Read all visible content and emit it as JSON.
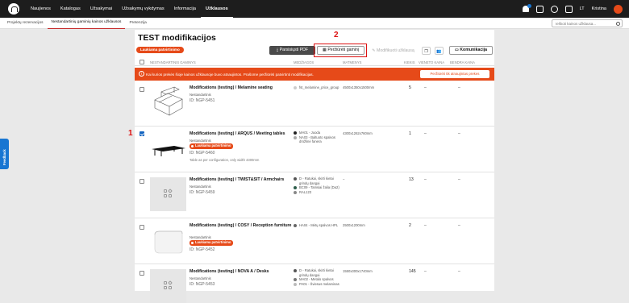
{
  "topnav": {
    "items": [
      "Naujienos",
      "Katalogas",
      "Užsakymai",
      "Užsakymų vykdymas",
      "Informacija",
      "Užklausos"
    ],
    "active_index": 5,
    "language": "LT",
    "user": "Kristina"
  },
  "subtabs": {
    "items": [
      "Projektų rezervacijos",
      "Nestandartinių gaminių kainos užklausos",
      "Pretenzija"
    ],
    "active_index": 1
  },
  "search": {
    "placeholder": "Ieškoti kainos užklausa..."
  },
  "page": {
    "title": "TEST modifikacijos",
    "status": "Laukiama patvirtinimo"
  },
  "toolbar": {
    "pdf_label": "Parsisiųsti PDF",
    "view_label": "Peržiūrėti gaminį",
    "modify_label": "Modifikuoti užklausą",
    "comm_label": "Komunikacija"
  },
  "table": {
    "headers": [
      "NESTANDARTINIS GAMINYS",
      "MEDŽIAGOS",
      "MATMENYS",
      "KIEKIS",
      "VIENETO KAINA",
      "BENDRA KAINA"
    ]
  },
  "alert": {
    "text": "Kai kurios prekės šioje kainos užklausoje buvo atnaujintos. Prašome peržiūrėti patvirtinti modifikacijas.",
    "button": "Peržiūrėti tik atnaujintas prekes"
  },
  "rows": [
    {
      "name": "Modifications (testing) / Melamine seating",
      "type": "Nestandartinis",
      "id": "ID: NGP-5451",
      "materials": [
        {
          "text": "fst_melamine_price_group",
          "color": "#cccccc"
        }
      ],
      "dims": "4500x1350x1500mm",
      "qty": "5",
      "unit_price": "–",
      "total_price": "–",
      "checked": false,
      "badge": ""
    },
    {
      "name": "Modifications (testing) / ARQUS / Meeting tables",
      "type": "Nestandartinis",
      "id": "ID: NGP-5460",
      "note": "Table as per configuration, only width 4300mm",
      "materials": [
        {
          "text": "MA01 - Juoda",
          "color": "#222222"
        },
        {
          "text": "NA03 - Baltuoto spalvos drožlinė fanera",
          "color": "#aaaaaa"
        }
      ],
      "dims": "4300x1262x760mm",
      "qty": "1",
      "unit_price": "–",
      "total_price": "–",
      "checked": true,
      "badge": "Laukiama patvirtinimo"
    },
    {
      "name": "Modifications (testing) / TWIST&SIT / Armchairs",
      "type": "Nestandartinis",
      "id": "ID: NGP-5459",
      "materials": [
        {
          "text": "D - Ratukai, skirti kietai grindų dangai",
          "color": "#555555"
        },
        {
          "text": "BC09 - Tamsiai žalia (Da2)",
          "color": "#2e5d4b"
        },
        {
          "text": "RAL123",
          "color": "#888888"
        }
      ],
      "dims": "–",
      "qty": "13",
      "unit_price": "–",
      "total_price": "–",
      "checked": false,
      "badge": ""
    },
    {
      "name": "Modifications (testing) / COSY / Reception furniture",
      "type": "Nestandartinis",
      "id": "ID: NGP-5452",
      "materials": [
        {
          "text": "HA04 - Mėtų spalvos HPL",
          "color": "#666666"
        }
      ],
      "dims": "2500x1200mm",
      "qty": "2",
      "unit_price": "–",
      "total_price": "–",
      "checked": false,
      "badge": "Laukiama patvirtinimo"
    },
    {
      "name": "Modifications (testing) / NOVA A / Desks",
      "type": "Nestandartinis",
      "id": "ID: NGP-5453",
      "materials": [
        {
          "text": "D - Ratukai, skirti kietai grindų dangai",
          "color": "#555555"
        },
        {
          "text": "MA02 - Metalo spalvos",
          "color": "#777777"
        },
        {
          "text": "PA01 - Šviesus melaminas",
          "color": "#bbbbbb"
        }
      ],
      "dims": "1550x300x1740mm",
      "qty": "145",
      "unit_price": "–",
      "total_price": "–",
      "checked": false,
      "badge": ""
    }
  ],
  "feedback_label": "Feedback",
  "annotations": [
    "1",
    "2"
  ]
}
